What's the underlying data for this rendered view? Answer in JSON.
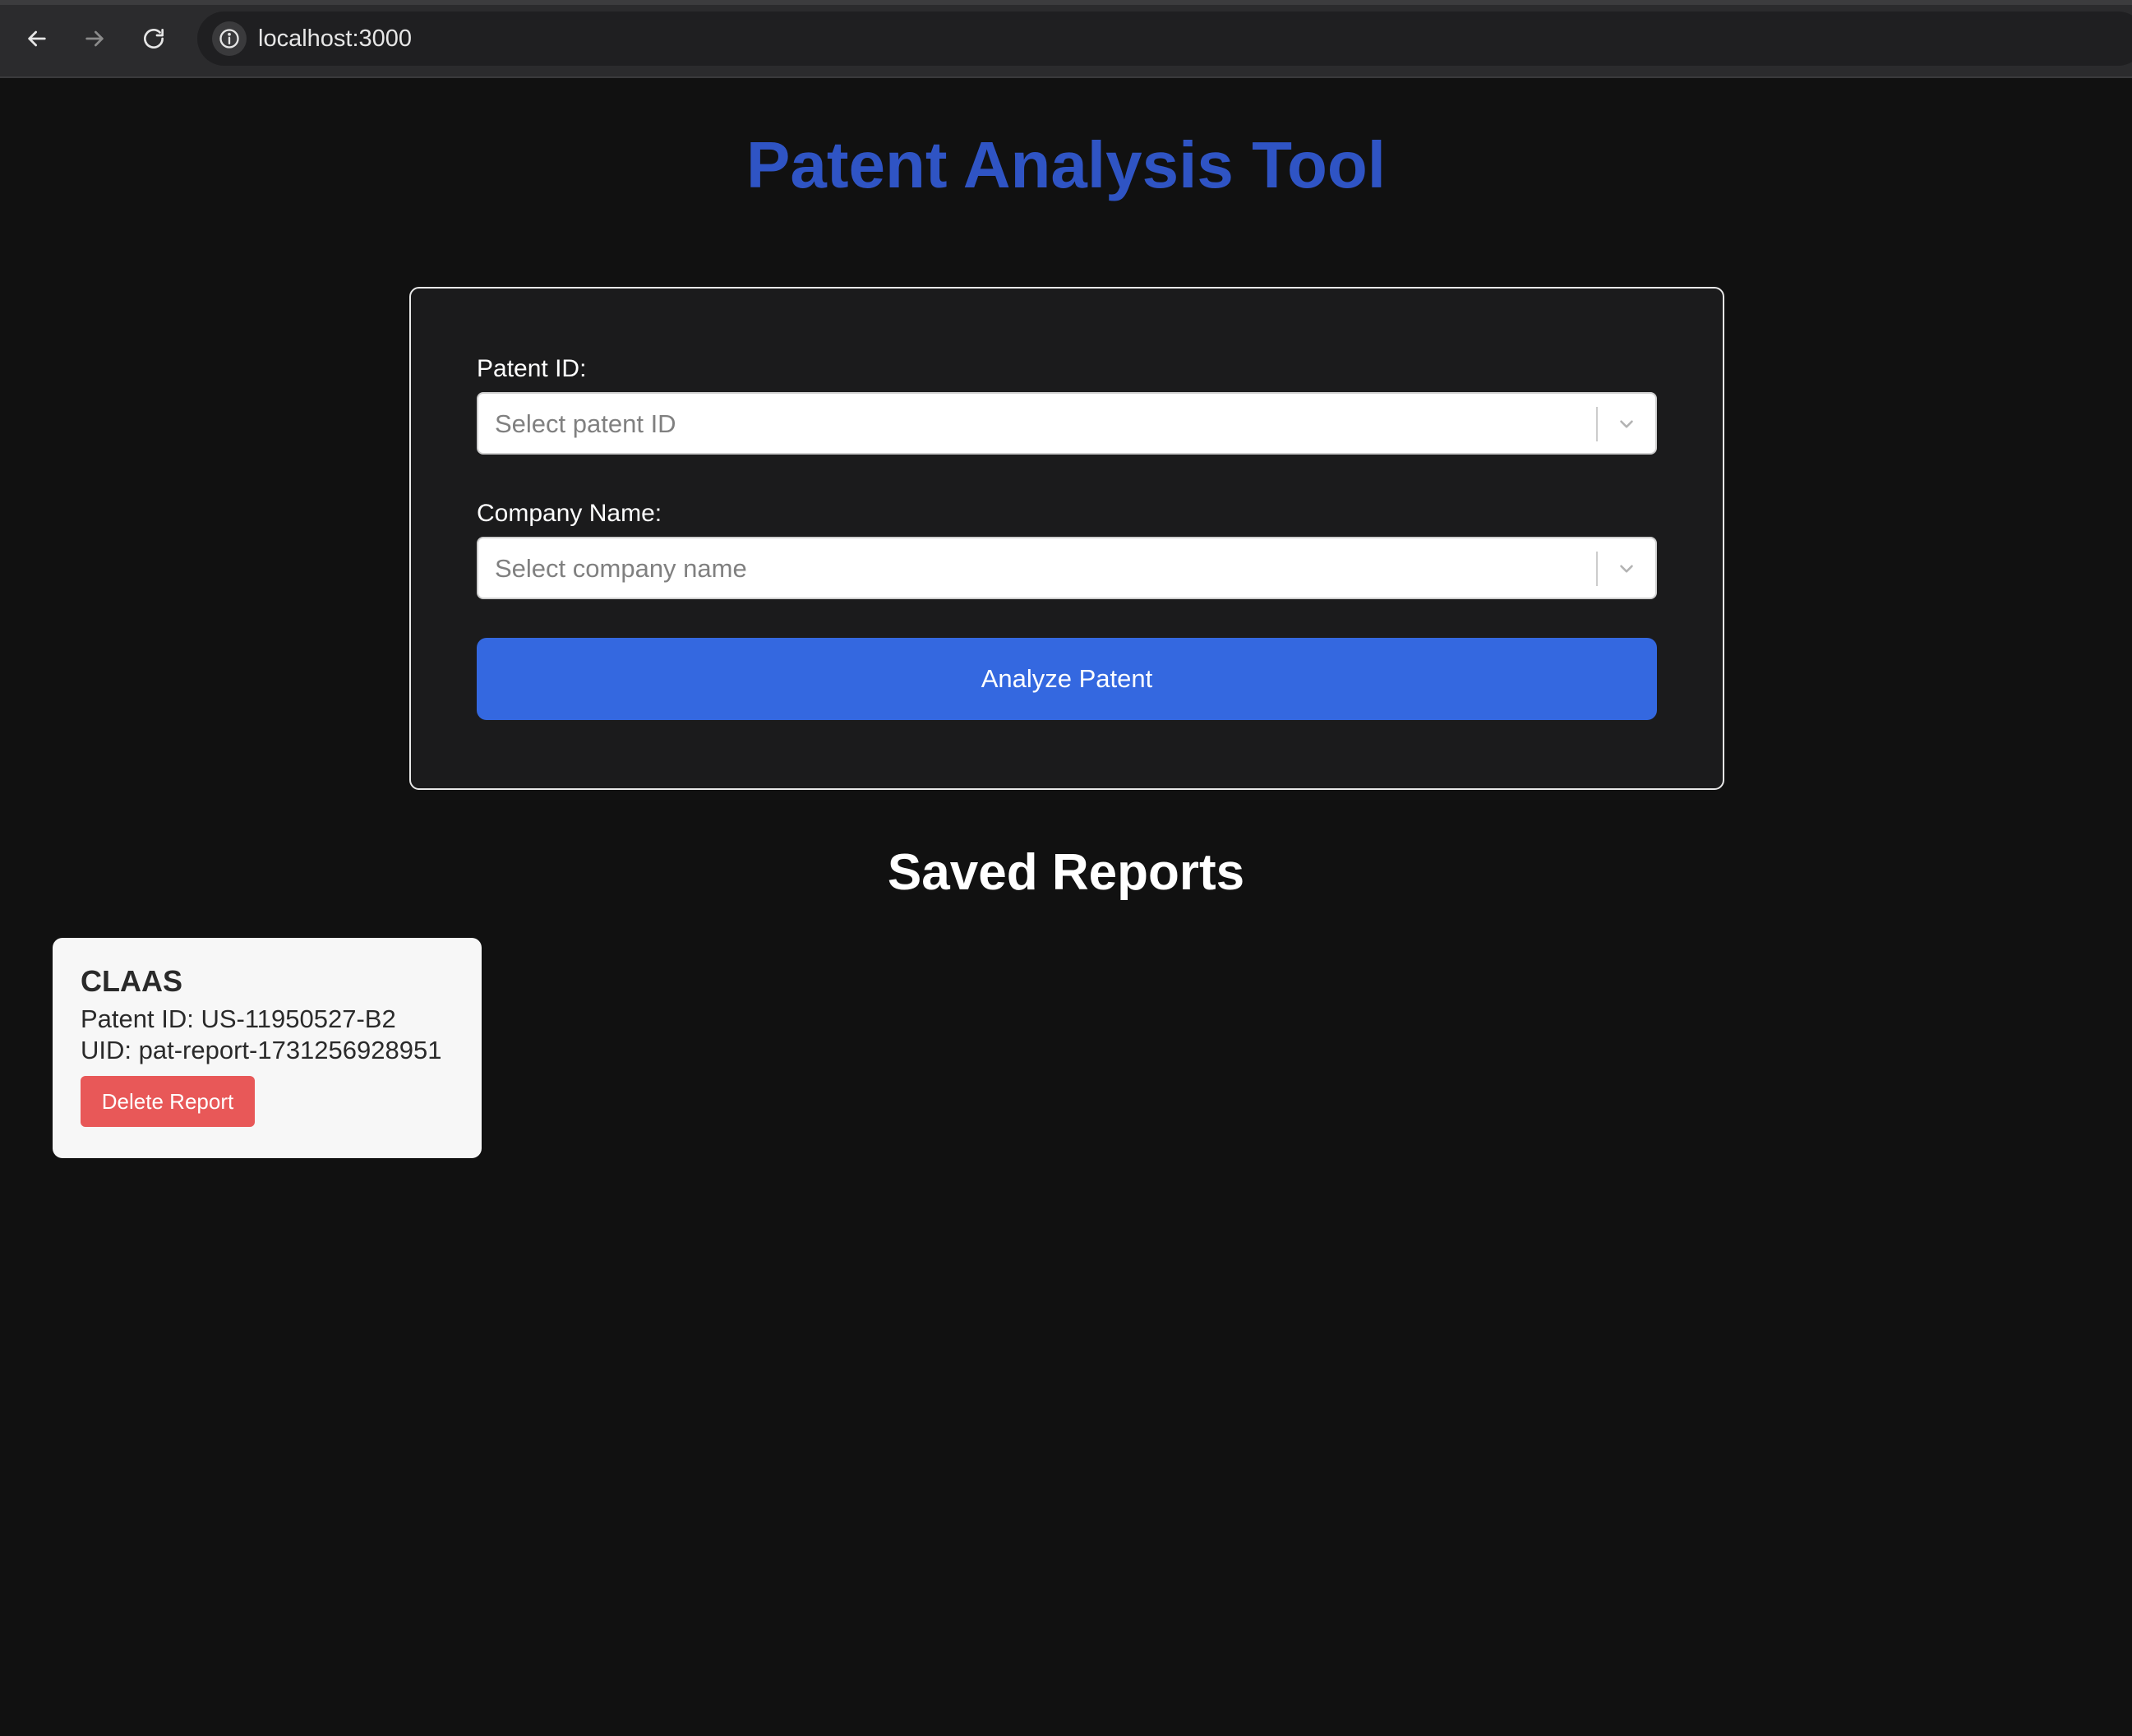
{
  "browser": {
    "url": "localhost:3000",
    "icons": [
      "back-arrow-icon",
      "forward-arrow-icon",
      "reload-icon",
      "info-icon"
    ]
  },
  "app": {
    "title": "Patent Analysis Tool",
    "title_color": "#2f54c4"
  },
  "form": {
    "patent_id_label": "Patent ID:",
    "patent_id_placeholder": "Select patent ID",
    "company_name_label": "Company Name:",
    "company_name_placeholder": "Select company name",
    "analyze_label": "Analyze Patent",
    "analyze_color": "#3468e0"
  },
  "saved_reports": {
    "title": "Saved Reports",
    "items": [
      {
        "company": "CLAAS",
        "patent_id_text": "Patent ID: US-11950527-B2",
        "uid_text": "UID: pat-report-1731256928951",
        "delete_label": "Delete Report",
        "delete_color": "#e85858"
      }
    ]
  }
}
